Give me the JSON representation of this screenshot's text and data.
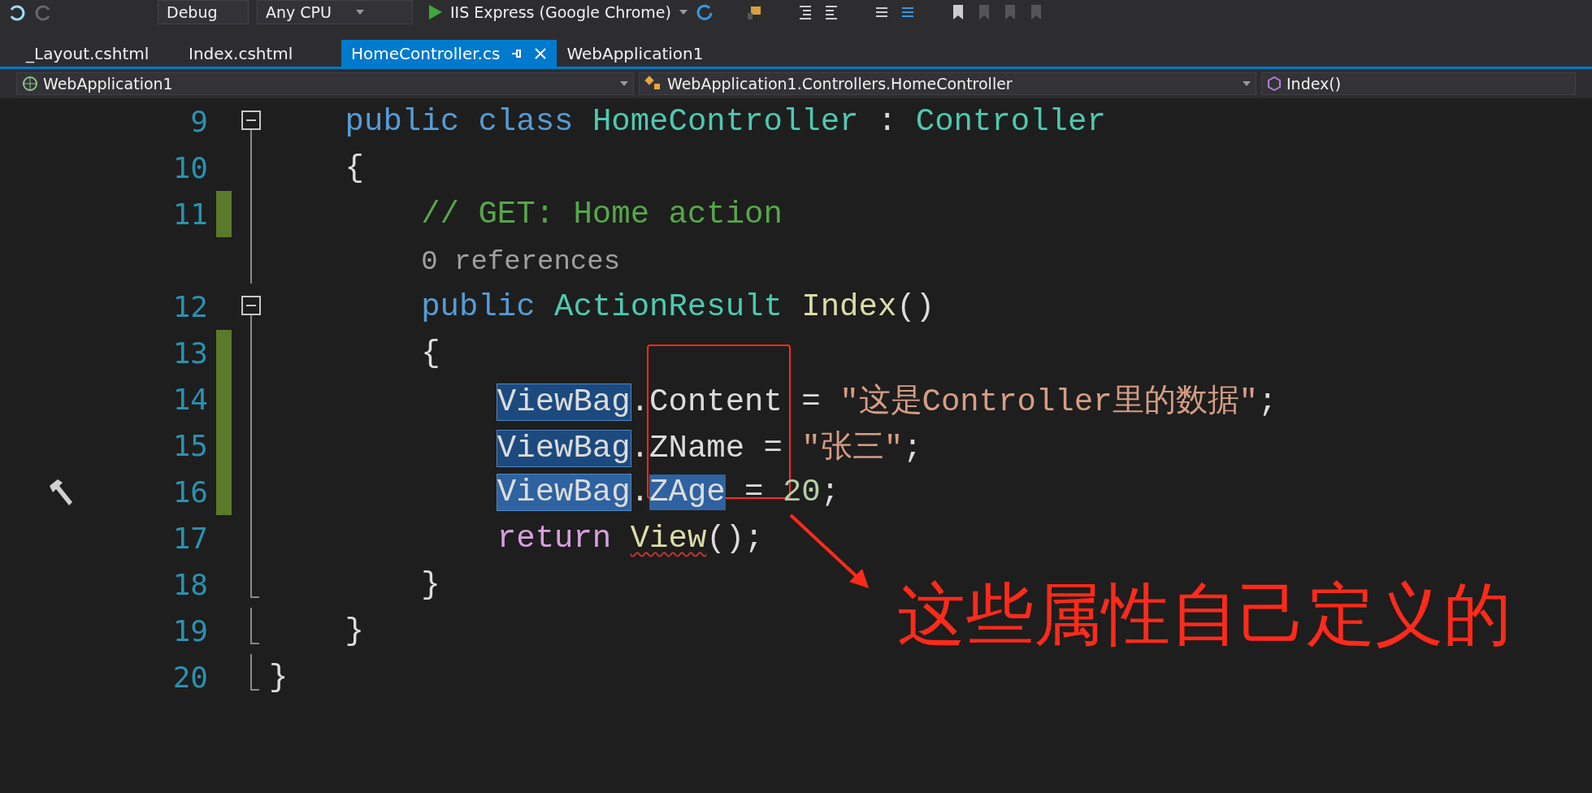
{
  "toolbar": {
    "items": [
      {
        "kind": "dropdown",
        "label": "Debug"
      },
      {
        "kind": "dropdown",
        "label": "Any CPU"
      },
      {
        "kind": "run",
        "label": "IIS Express (Google Chrome)"
      }
    ]
  },
  "tabs": [
    {
      "label": "_Layout.cshtml",
      "selected": false
    },
    {
      "label": "Index.cshtml",
      "selected": false
    },
    {
      "label": "HomeController.cs",
      "selected": true
    },
    {
      "label": "WebApplication1",
      "selected": false
    }
  ],
  "navigation_bar": {
    "project": "WebApplication1",
    "type": "WebApplication1.Controllers.HomeController",
    "member": "Index()"
  },
  "editor": {
    "lines": [
      {
        "children": [
          {
            "number": "9",
            "changed": false,
            "collapsible": true,
            "fold_end": false,
            "tokens": [
              {
                "kind": "keyword",
                "text": "public "
              },
              {
                "kind": "keyword",
                "text": "class "
              },
              {
                "kind": "type",
                "text": "HomeController"
              },
              {
                "kind": "plain",
                "text": " : "
              },
              {
                "kind": "type",
                "text": "Controller"
              }
            ]
          },
          {
            "number": "10",
            "changed": false,
            "collapsible": false,
            "fold_end": false,
            "tokens": [
              {
                "kind": "plain",
                "text": "{"
              }
            ]
          },
          {
            "children": [
              {
                "number": "11",
                "changed": true,
                "collapsible": false,
                "fold_end": false,
                "tokens": [
                  {
                    "kind": "comment",
                    "text": "// GET: Home action"
                  }
                ]
              },
              {
                "changed": false,
                "collapsible": false,
                "fold_end": false,
                "tokens": [
                  {
                    "kind": "lens",
                    "text": "0 references"
                  }
                ]
              },
              {
                "number": "12",
                "changed": false,
                "collapsible": true,
                "fold_end": false,
                "tokens": [
                  {
                    "kind": "keyword",
                    "text": "public "
                  },
                  {
                    "kind": "type",
                    "text": "ActionResult "
                  },
                  {
                    "kind": "method",
                    "text": "Index"
                  },
                  {
                    "kind": "plain",
                    "text": "()"
                  }
                ]
              },
              {
                "number": "13",
                "changed": true,
                "collapsible": false,
                "fold_end": false,
                "tokens": [
                  {
                    "kind": "plain",
                    "text": "{"
                  }
                ]
              },
              {
                "children": [
                  {
                    "number": "14",
                    "changed": true,
                    "collapsible": false,
                    "fold_end": false,
                    "tokens": [
                      {
                        "kind": "plain",
                        "text": "ViewBag",
                        "highlighted": true,
                        "selected": false
                      },
                      {
                        "kind": "plain",
                        "text": "."
                      },
                      {
                        "kind": "plain",
                        "text": "Content"
                      },
                      {
                        "kind": "plain",
                        "text": " = "
                      },
                      {
                        "kind": "string",
                        "text": "\"这是Controller里的数据\""
                      },
                      {
                        "kind": "plain",
                        "text": ";"
                      }
                    ]
                  },
                  {
                    "number": "15",
                    "changed": true,
                    "collapsible": false,
                    "fold_end": false,
                    "tokens": [
                      {
                        "kind": "plain",
                        "text": "ViewBag",
                        "highlighted": true,
                        "selected": false
                      },
                      {
                        "kind": "plain",
                        "text": "."
                      },
                      {
                        "kind": "plain",
                        "text": "ZName"
                      },
                      {
                        "kind": "plain",
                        "text": " = "
                      },
                      {
                        "kind": "string",
                        "text": "\"张三\""
                      },
                      {
                        "kind": "plain",
                        "text": ";"
                      }
                    ]
                  },
                  {
                    "number": "16",
                    "changed": true,
                    "collapsible": false,
                    "fold_end": false,
                    "build_glyph": true,
                    "tokens": [
                      {
                        "kind": "plain",
                        "text": "ViewBag",
                        "highlighted": true,
                        "selected": true
                      },
                      {
                        "kind": "plain",
                        "text": "."
                      },
                      {
                        "kind": "plain",
                        "text": "ZAge",
                        "highlighted": false,
                        "selected": true
                      },
                      {
                        "kind": "plain",
                        "text": " = "
                      },
                      {
                        "kind": "number",
                        "text": "20"
                      },
                      {
                        "kind": "plain",
                        "text": ";"
                      }
                    ]
                  },
                  {
                    "number": "17",
                    "changed": false,
                    "collapsible": false,
                    "fold_end": false,
                    "tokens": [
                      {
                        "kind": "control",
                        "text": "return "
                      },
                      {
                        "kind": "method",
                        "text": "View",
                        "squiggle": true
                      },
                      {
                        "kind": "plain",
                        "text": "();"
                      }
                    ]
                  }
                ]
              },
              {
                "number": "18",
                "changed": false,
                "collapsible": false,
                "fold_end": true,
                "tokens": [
                  {
                    "kind": "plain",
                    "text": "}"
                  }
                ]
              }
            ]
          },
          {
            "number": "19",
            "changed": false,
            "collapsible": false,
            "fold_end": true,
            "tokens": [
              {
                "kind": "plain",
                "text": "}"
              }
            ]
          }
        ]
      },
      {
        "number": "20",
        "changed": false,
        "collapsible": false,
        "fold_end": true,
        "tokens": [
          {
            "kind": "plain",
            "text": "}"
          }
        ]
      }
    ]
  },
  "annotation": {
    "text": "这些属性自己定义的"
  }
}
